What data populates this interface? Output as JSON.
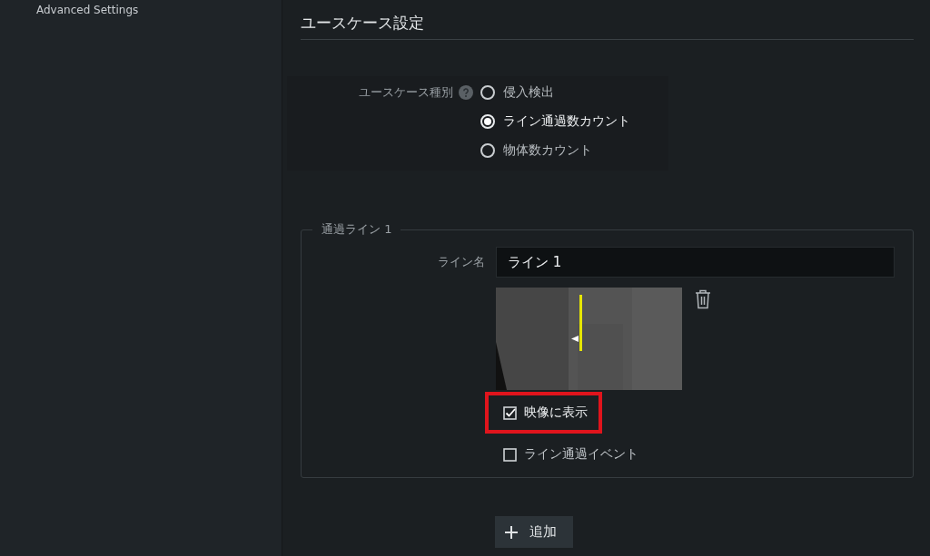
{
  "sidebar": {
    "title": "Advanced Settings"
  },
  "section": {
    "title": "ユースケース設定"
  },
  "use_case": {
    "label": "ユースケース種別",
    "options": [
      {
        "label": "侵入検出",
        "selected": false
      },
      {
        "label": "ライン通過数カウント",
        "selected": true
      },
      {
        "label": "物体数カウント",
        "selected": false
      }
    ]
  },
  "line": {
    "legend": "通過ライン 1",
    "name_label": "ライン名",
    "name_value": "ライン 1",
    "checkboxes": [
      {
        "label": "映像に表示",
        "checked": true,
        "highlighted": true
      },
      {
        "label": "ライン通過イベント",
        "checked": false,
        "highlighted": false
      }
    ]
  },
  "add_button": {
    "label": "追加"
  }
}
